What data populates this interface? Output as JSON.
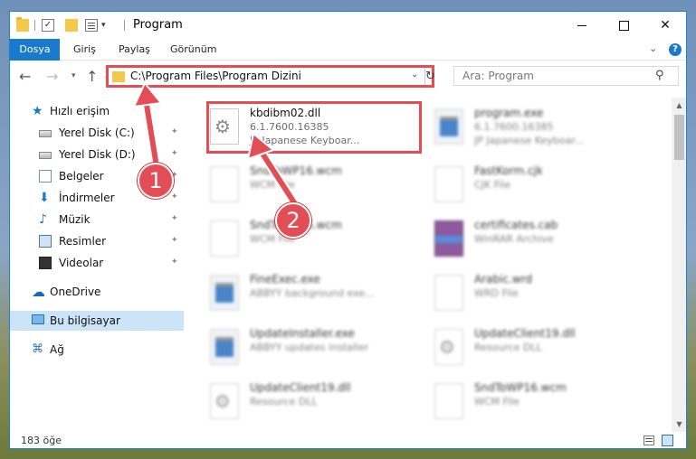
{
  "window": {
    "title": "Program",
    "qa_check": "✓",
    "qa_dropdown": "▾",
    "minimize_label": "",
    "maximize_label": "",
    "close_label": "✕"
  },
  "ribbon": {
    "tabs": [
      "Dosya",
      "Giriş",
      "Paylaş",
      "Görünüm"
    ],
    "collapse": "⌄",
    "help": "?"
  },
  "nav": {
    "back": "←",
    "forward": "→",
    "recent": "▾",
    "up": "↑",
    "address": "C:\\Program Files\\Program Dizini",
    "address_dropdown": "⌄",
    "refresh": "↻",
    "search_placeholder": "Ara: Program",
    "search_icon": "⚲"
  },
  "sidebar": {
    "items": [
      {
        "label": "Hızlı erişim",
        "icon": "star-icon",
        "glyph": "★",
        "pinned": false
      },
      {
        "label": "Yerel Disk (C:)",
        "icon": "drive-icon",
        "pinned": true
      },
      {
        "label": "Yerel Disk (D:)",
        "icon": "drive-icon",
        "pinned": true
      },
      {
        "label": "Belgeler",
        "icon": "documents-icon",
        "pinned": true
      },
      {
        "label": "İndirmeler",
        "icon": "download-icon",
        "glyph": "⬇",
        "pinned": true
      },
      {
        "label": "Müzik",
        "icon": "music-icon",
        "glyph": "♪",
        "pinned": true
      },
      {
        "label": "Resimler",
        "icon": "pictures-icon",
        "pinned": true
      },
      {
        "label": "Videolar",
        "icon": "video-icon",
        "pinned": true
      },
      {
        "label": "OneDrive",
        "icon": "cloud-icon",
        "glyph": "☁"
      },
      {
        "label": "Bu bilgisayar",
        "icon": "computer-icon",
        "selected": true
      },
      {
        "label": "Ağ",
        "icon": "network-icon",
        "glyph": "⌘"
      }
    ],
    "pin_glyph": "✦"
  },
  "files": [
    {
      "name": "kbdibm02.dll",
      "meta1": "6.1.7600.16385",
      "meta2": "JP Japanese Keyboar...",
      "icon": "gear",
      "highlight": true
    },
    {
      "name": "program.exe",
      "meta1": "6.1.7600.16385",
      "meta2": "JP Japanese Keyboar...",
      "icon": "exe"
    },
    {
      "name": "SndToWP16.wcm",
      "meta1": "WCM File",
      "meta2": "",
      "icon": "doc"
    },
    {
      "name": "FastKorm.cjk",
      "meta1": "CJK File",
      "meta2": "",
      "icon": "doc"
    },
    {
      "name": "SndToWP16.wcm",
      "meta1": "WCM File",
      "meta2": "",
      "icon": "doc"
    },
    {
      "name": "certificates.cab",
      "meta1": "WinRAR Archive",
      "meta2": "",
      "icon": "rar"
    },
    {
      "name": "FineExec.exe",
      "meta1": "ABBYY background exe...",
      "meta2": "",
      "icon": "exe"
    },
    {
      "name": "Arabic.wrd",
      "meta1": "WRD File",
      "meta2": "",
      "icon": "doc"
    },
    {
      "name": "UpdateInstaller.exe",
      "meta1": "ABBYY updates installer",
      "meta2": "",
      "icon": "exe"
    },
    {
      "name": "UpdateClient19.dll",
      "meta1": "Resource DLL",
      "meta2": "",
      "icon": "gear"
    },
    {
      "name": "UpdateClient19.dll",
      "meta1": "Resource DLL",
      "meta2": "",
      "icon": "gear"
    },
    {
      "name": "SndToWP16.wcm",
      "meta1": "WCM File",
      "meta2": "",
      "icon": "doc"
    }
  ],
  "scroll": {
    "up": "▲",
    "down": "▼"
  },
  "status": {
    "count": "183 öğe"
  },
  "annotations": {
    "badge1": "1",
    "badge2": "2",
    "accent": "#e34d55"
  }
}
